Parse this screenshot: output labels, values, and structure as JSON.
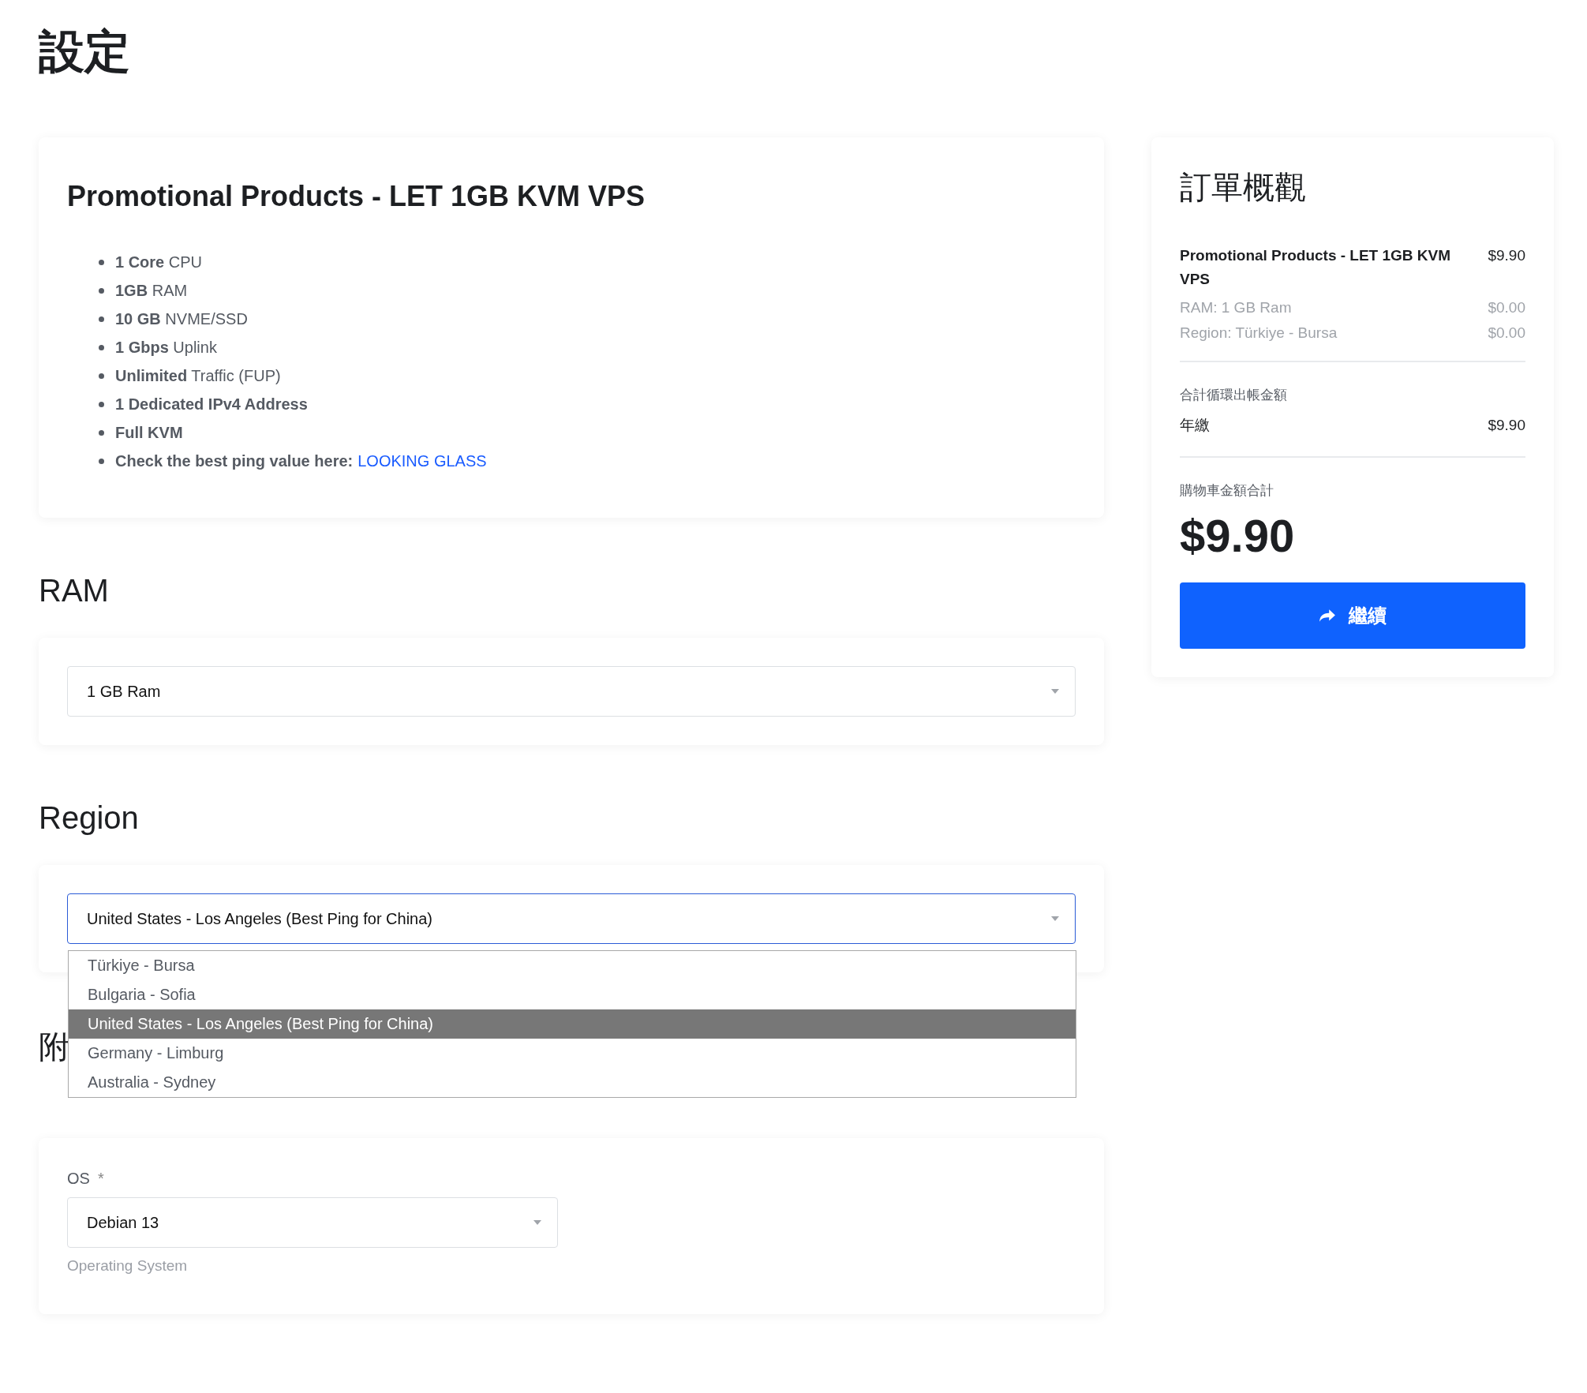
{
  "page_title": "設定",
  "product": {
    "title": "Promotional Products - LET 1GB KVM VPS",
    "features": [
      {
        "text": "**1 Core** CPU"
      },
      {
        "text": "**1GB** RAM"
      },
      {
        "text": "**10 GB** NVME/SSD"
      },
      {
        "text": "**1 Gbps** Uplink"
      },
      {
        "text": "**Unlimited** Traffic (FUP)"
      },
      {
        "text": "**1 Dedicated IPv4 Address**"
      },
      {
        "text": "**Full KVM**"
      },
      {
        "text": "**Check the best ping value here:**",
        "link": "LOOKING GLASS"
      }
    ]
  },
  "ram": {
    "heading": "RAM",
    "value": "1 GB Ram"
  },
  "region": {
    "heading": "Region",
    "value": "United States - Los Angeles (Best Ping for China)",
    "expanded": true,
    "options": [
      {
        "label": "Türkiye - Bursa",
        "selected": false
      },
      {
        "label": "Bulgaria - Sofia",
        "selected": false
      },
      {
        "label": "United States - Los Angeles (Best Ping for China)",
        "selected": true
      },
      {
        "label": "Germany - Limburg",
        "selected": false
      },
      {
        "label": "Australia - Sydney",
        "selected": false
      }
    ]
  },
  "additional": {
    "heading": "附"
  },
  "os": {
    "label": "OS",
    "required_mark": "*",
    "value": "Debian 13",
    "help": "Operating System"
  },
  "summary": {
    "title": "訂單概觀",
    "lines": [
      {
        "label": "Promotional Products - LET 1GB KVM VPS",
        "price": "$9.90",
        "kind": "product"
      },
      {
        "label": "RAM: 1 GB Ram",
        "price": "$0.00",
        "kind": "option"
      },
      {
        "label": "Region: Türkiye - Bursa",
        "price": "$0.00",
        "kind": "option"
      }
    ],
    "recurring_label": "合計循環出帳金額",
    "recurring": [
      {
        "label": "年繳",
        "price": "$9.90"
      }
    ],
    "total_label": "購物車金額合計",
    "total": "$9.90",
    "button": "繼續"
  }
}
